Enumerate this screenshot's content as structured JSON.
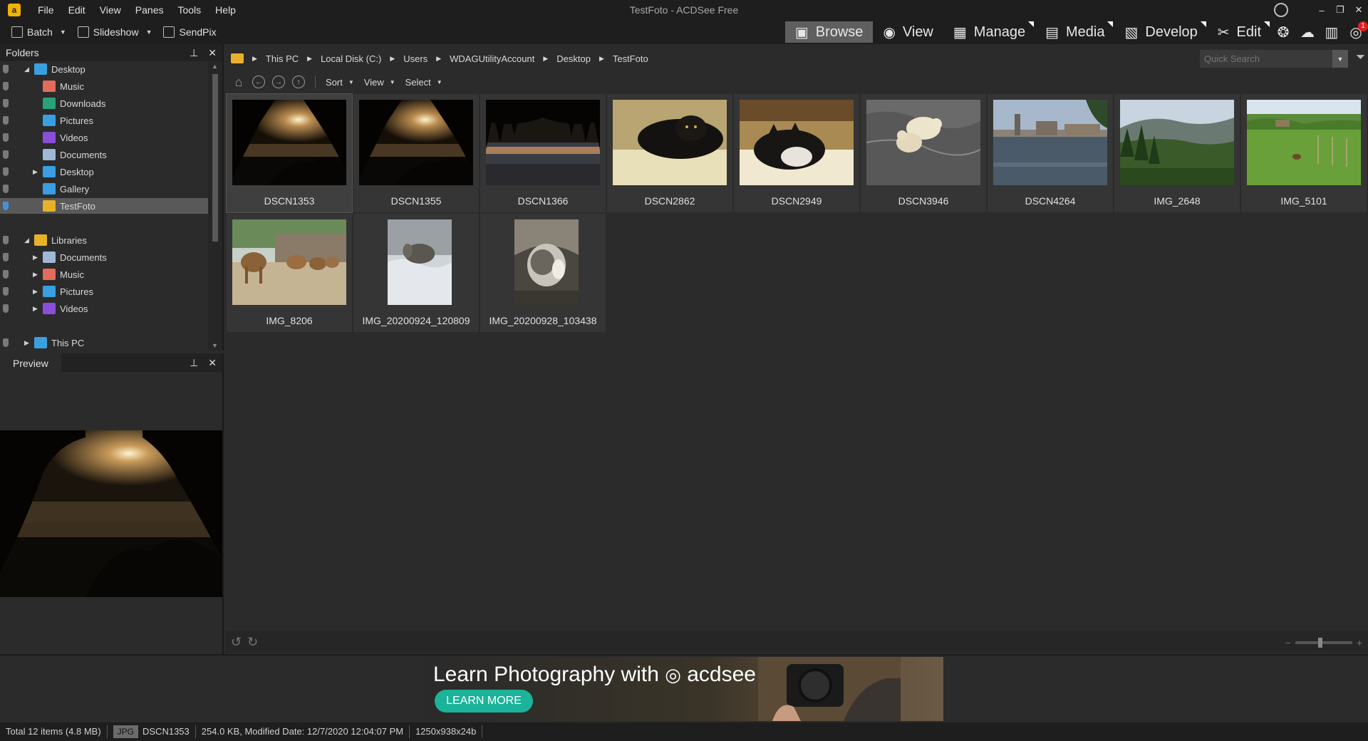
{
  "window": {
    "title": "TestFoto - ACDSee Free",
    "logo_letter": "a",
    "minimize": "–",
    "maximize": "❐",
    "close": "✕"
  },
  "menu": [
    "File",
    "Edit",
    "View",
    "Panes",
    "Tools",
    "Help"
  ],
  "toolbar": {
    "batch": "Batch",
    "slideshow": "Slideshow",
    "sendpix": "SendPix"
  },
  "modes": {
    "browse": "Browse",
    "view": "View",
    "manage": "Manage",
    "media": "Media",
    "develop": "Develop",
    "edit": "Edit",
    "notification_count": "1",
    "icons": [
      "browse-icon",
      "eye-icon",
      "grid-icon",
      "media-icon",
      "develop-icon",
      "edit-icon",
      "community-icon",
      "cloud-365-icon",
      "stats-icon",
      "eye-notification-icon"
    ]
  },
  "folders_pane": {
    "title": "Folders",
    "tree": [
      {
        "label": "Desktop",
        "level": 1,
        "expander": "open",
        "icon": "desktop-folder-icon",
        "color": "#3a9fe0"
      },
      {
        "label": "Music",
        "level": 2,
        "expander": "",
        "icon": "music-folder-icon",
        "color": "#e36b5b"
      },
      {
        "label": "Downloads",
        "level": 2,
        "expander": "",
        "icon": "downloads-folder-icon",
        "color": "#2aa17a"
      },
      {
        "label": "Pictures",
        "level": 2,
        "expander": "",
        "icon": "pictures-folder-icon",
        "color": "#3a9fe0"
      },
      {
        "label": "Videos",
        "level": 2,
        "expander": "",
        "icon": "videos-folder-icon",
        "color": "#8a4fd8"
      },
      {
        "label": "Documents",
        "level": 2,
        "expander": "",
        "icon": "documents-folder-icon",
        "color": "#a0b8d8"
      },
      {
        "label": "Desktop",
        "level": 2,
        "expander": "closed",
        "icon": "desktop-folder-icon",
        "color": "#3a9fe0"
      },
      {
        "label": "Gallery",
        "level": 2,
        "expander": "",
        "icon": "gallery-folder-icon",
        "color": "#3a9fe0"
      },
      {
        "label": "TestFoto",
        "level": 2,
        "expander": "",
        "icon": "folder-icon",
        "color": "#e8b12a",
        "selected": true
      },
      {
        "label": "",
        "level": 0,
        "expander": "",
        "icon": "",
        "color": "",
        "spacer": true
      },
      {
        "label": "Libraries",
        "level": 1,
        "expander": "open",
        "icon": "libraries-folder-icon",
        "color": "#e8b12a"
      },
      {
        "label": "Documents",
        "level": 2,
        "expander": "closed",
        "icon": "documents-folder-icon",
        "color": "#a0b8d8"
      },
      {
        "label": "Music",
        "level": 2,
        "expander": "closed",
        "icon": "music-folder-icon",
        "color": "#e36b5b"
      },
      {
        "label": "Pictures",
        "level": 2,
        "expander": "closed",
        "icon": "pictures-folder-icon",
        "color": "#3a9fe0"
      },
      {
        "label": "Videos",
        "level": 2,
        "expander": "closed",
        "icon": "videos-folder-icon",
        "color": "#8a4fd8"
      },
      {
        "label": "",
        "level": 0,
        "expander": "",
        "icon": "",
        "color": "",
        "spacer": true
      },
      {
        "label": "This PC",
        "level": 1,
        "expander": "closed",
        "icon": "pc-icon",
        "color": "#3a9fe0"
      }
    ]
  },
  "preview_pane": {
    "title": "Preview"
  },
  "address": {
    "crumbs": [
      "This PC",
      "Local Disk (C:)",
      "Users",
      "WDAGUtilityAccount",
      "Desktop",
      "TestFoto"
    ],
    "search_placeholder": "Quick Search"
  },
  "nav": {
    "sort": "Sort",
    "view": "View",
    "select": "Select"
  },
  "thumbnails": [
    {
      "name": "DSCN1353",
      "scene": "sunset",
      "selected": true
    },
    {
      "name": "DSCN1355",
      "scene": "sunset"
    },
    {
      "name": "DSCN1366",
      "scene": "sunset-water"
    },
    {
      "name": "DSCN2862",
      "scene": "cat-black"
    },
    {
      "name": "DSCN2949",
      "scene": "cat-bed"
    },
    {
      "name": "DSCN3946",
      "scene": "polar-bears"
    },
    {
      "name": "DSCN4264",
      "scene": "city-river"
    },
    {
      "name": "IMG_2648",
      "scene": "hills"
    },
    {
      "name": "IMG_5101",
      "scene": "meadow"
    },
    {
      "name": "IMG_8206",
      "scene": "camels"
    },
    {
      "name": "IMG_20200924_120809",
      "scene": "cat-sheet",
      "portrait": true
    },
    {
      "name": "IMG_20200928_103438",
      "scene": "cat-grey",
      "portrait": true
    }
  ],
  "ad": {
    "headline": "Learn Photography with",
    "brand": "acdsee",
    "button": "LEARN MORE"
  },
  "status": {
    "total": "Total 12 items  (4.8 MB)",
    "file_type": "JPG",
    "file_name": "DSCN1353",
    "file_info": "254.0 KB, Modified Date: 12/7/2020 12:04:07 PM",
    "dimensions": "1250x938x24b"
  }
}
